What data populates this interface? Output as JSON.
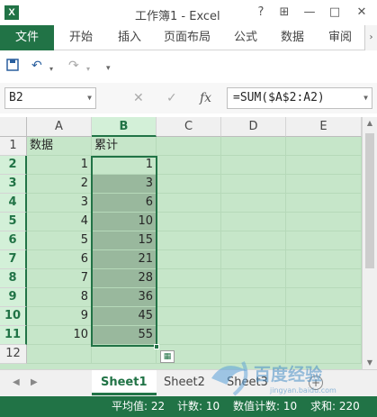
{
  "window": {
    "app_icon": "X",
    "title": "工作簿1 - Excel",
    "buttons": [
      "?",
      "⊞",
      "—",
      "□",
      "✕"
    ]
  },
  "ribbon": {
    "file_tab": "文件",
    "tabs": [
      "开始",
      "插入",
      "页面布局",
      "公式",
      "数据",
      "审阅"
    ]
  },
  "formula_bar": {
    "name_box": "B2",
    "formula": "=SUM($A$2:A2)"
  },
  "grid": {
    "columns": [
      "A",
      "B",
      "C",
      "D",
      "E"
    ],
    "selected_column": "B",
    "rows": [
      {
        "n": "1",
        "a": "数据",
        "b": "累计"
      },
      {
        "n": "2",
        "a": "1",
        "b": "1"
      },
      {
        "n": "3",
        "a": "2",
        "b": "3"
      },
      {
        "n": "4",
        "a": "3",
        "b": "6"
      },
      {
        "n": "5",
        "a": "4",
        "b": "10"
      },
      {
        "n": "6",
        "a": "5",
        "b": "15"
      },
      {
        "n": "7",
        "a": "6",
        "b": "21"
      },
      {
        "n": "8",
        "a": "7",
        "b": "28"
      },
      {
        "n": "9",
        "a": "8",
        "b": "36"
      },
      {
        "n": "10",
        "a": "9",
        "b": "45"
      },
      {
        "n": "11",
        "a": "10",
        "b": "55"
      },
      {
        "n": "12",
        "a": "",
        "b": ""
      }
    ]
  },
  "sheets": {
    "tabs": [
      "Sheet1",
      "Sheet2",
      "Sheet3"
    ],
    "active": "Sheet1"
  },
  "status": {
    "average": "平均值: 22",
    "count": "计数: 10",
    "numeric_count": "数值计数: 10",
    "sum": "求和: 220"
  },
  "watermark": {
    "text": "百度经验",
    "url": "jingyan.baidu.com"
  },
  "colors": {
    "accent": "#217346",
    "grid_bg": "#c6e6c9",
    "selection": "#99b89d"
  }
}
